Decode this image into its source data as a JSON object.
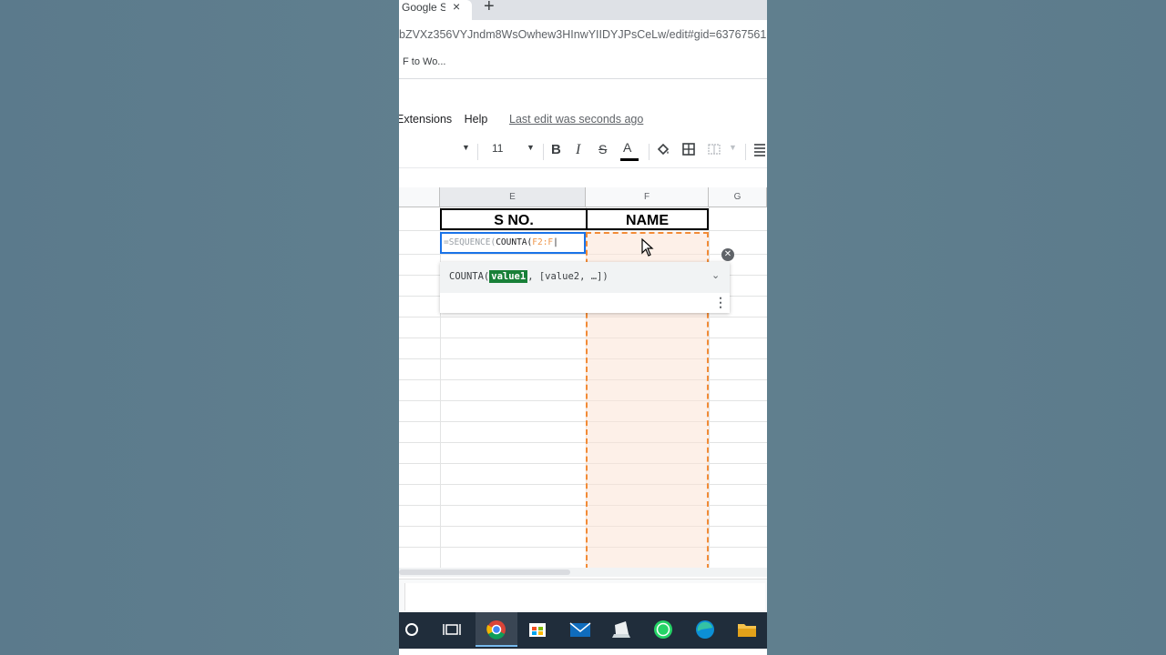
{
  "browser": {
    "tab_title": "Google Sh",
    "tab_close": "×",
    "new_tab": "+",
    "url": "bZVXz356VYJndm8WsOwhew3HInwYIIDYJPsCeLw/edit#gid=637675617",
    "bookmark": "F to Wo..."
  },
  "menu": {
    "items": [
      "Extensions",
      "Help"
    ],
    "last_edit": "Last edit was seconds ago"
  },
  "toolbar": {
    "font_size": "11",
    "bold": "B",
    "italic": "I",
    "strikethrough": "S",
    "text_color": "A"
  },
  "grid": {
    "columns": [
      "E",
      "F",
      "G"
    ],
    "headers": {
      "e": "S NO.",
      "f": "NAME"
    },
    "formula_parts": {
      "prefix": "=SEQUENCE(",
      "func": "COUNTA(",
      "range": "F2:F"
    }
  },
  "autocomplete": {
    "func": "COUNTA(",
    "arg_highlight": "value1",
    "rest": ", [value2, …])"
  },
  "taskbar": {
    "apps": [
      "cortana-icon",
      "task-view-icon",
      "chrome-icon",
      "store-icon",
      "mail-icon",
      "scanner-icon",
      "whatsapp-icon",
      "edge-icon",
      "file-explorer-icon"
    ],
    "active": "chrome-icon"
  }
}
